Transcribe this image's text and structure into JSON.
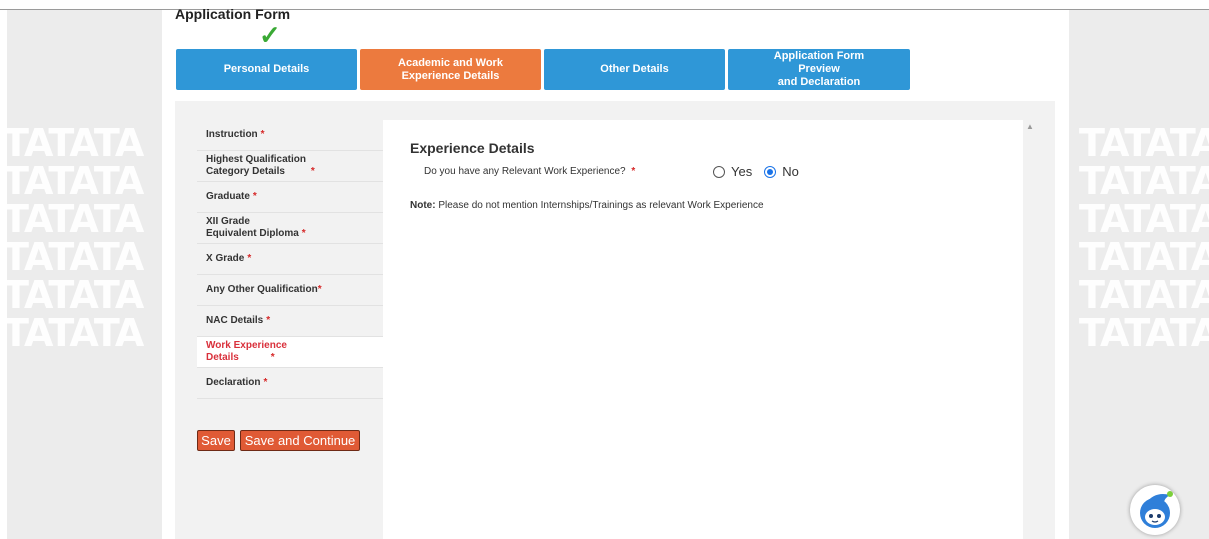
{
  "watermark_text": "TATATA",
  "app": {
    "title": "Application Form"
  },
  "steps": [
    {
      "line1": "Personal Details",
      "line2": "",
      "completed": true
    },
    {
      "line1": "Academic and Work",
      "line2": "Experience Details",
      "active": true
    },
    {
      "line1": "Other Details",
      "line2": ""
    },
    {
      "line1": "Application Form Preview",
      "line2": "and Declaration"
    }
  ],
  "sidebar": {
    "items": [
      {
        "label": "Instruction",
        "l2": "",
        "required": "*"
      },
      {
        "label": "Highest Qualification",
        "l2": "Category Details",
        "required": "*"
      },
      {
        "label": "Graduate",
        "l2": "",
        "required": "*"
      },
      {
        "label": "XII Grade",
        "l2": "Equivalent Diploma",
        "required": "*"
      },
      {
        "label": "X Grade",
        "l2": "",
        "required": "*"
      },
      {
        "label": "Any Other Qualification",
        "l2": "",
        "required": "*"
      },
      {
        "label": "NAC Details",
        "l2": "",
        "required": "*"
      },
      {
        "label": "Work Experience",
        "l2": "Details",
        "required": "*",
        "active": true
      },
      {
        "label": "Declaration",
        "l2": "",
        "required": "*"
      }
    ]
  },
  "buttons": {
    "save": "Save",
    "save_continue": "Save and Continue"
  },
  "content": {
    "section_title": "Experience Details",
    "question": "Do you have any Relevant Work Experience?",
    "required": "*",
    "options": [
      "Yes",
      "No"
    ],
    "selected": "No",
    "note_label": "Note:",
    "note_text": "Please do not mention Internships/Trainings as relevant Work Experience"
  },
  "colors": {
    "step_blue": "#2f97d7",
    "step_active": "#ec7a3e",
    "button": "#e05a35",
    "required": "#d62828",
    "check": "#3aa935"
  }
}
